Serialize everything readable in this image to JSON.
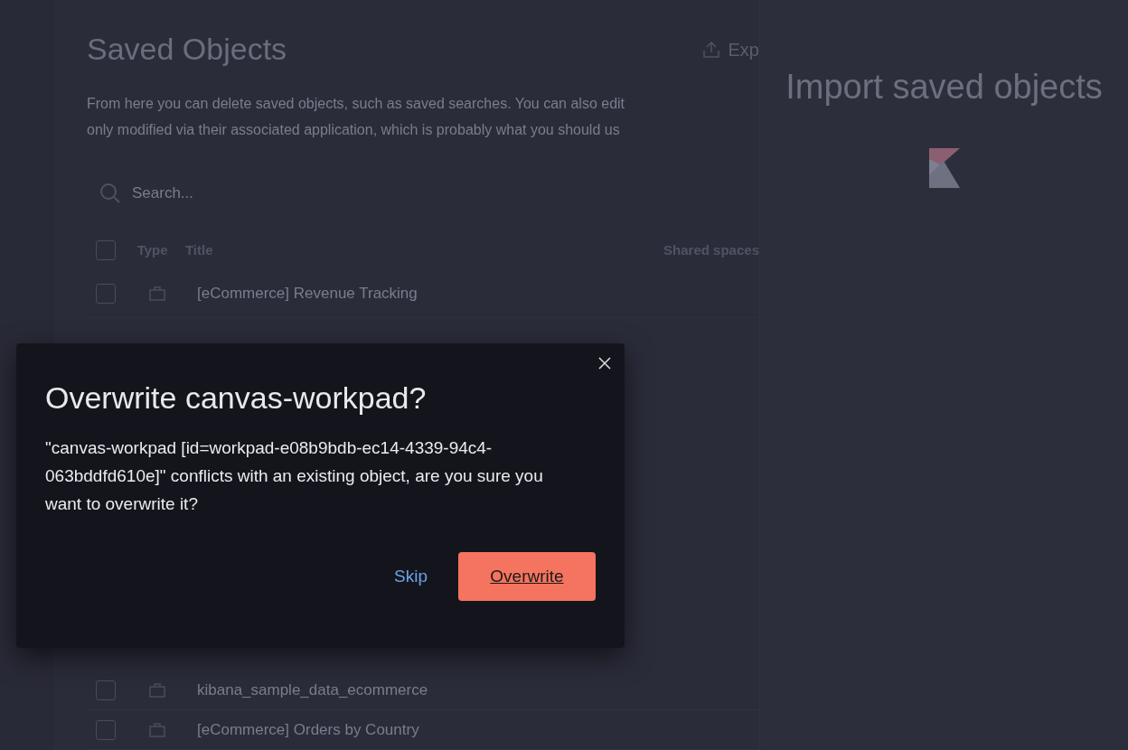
{
  "page": {
    "title": "Saved Objects",
    "export_button": "Exp",
    "description_lines": [
      "From here you can delete saved objects, such as saved searches. You can also edit",
      "only modified via their associated application, which is probably what you should us"
    ],
    "search": {
      "placeholder": "Search..."
    },
    "table": {
      "select_all_checked": false,
      "columns": [
        "Type",
        "Title",
        "Shared spaces"
      ],
      "rows_top": [
        {
          "title": "[eCommerce] Revenue Tracking",
          "checked": false
        }
      ],
      "rows_bottom": [
        {
          "title": "kibana_sample_data_ecommerce",
          "checked": false
        },
        {
          "title": "[eCommerce] Orders by Country",
          "checked": false
        }
      ]
    }
  },
  "flyout": {
    "title": "Import saved objects"
  },
  "modal": {
    "title": "Overwrite canvas-workpad?",
    "message": "\"canvas-workpad [id=workpad-e08b9bdb-ec14-4339-94c4-063bddfd610e]\" conflicts with an existing object, are you sure you want to overwrite it?",
    "buttons": [
      {
        "label": "Skip",
        "kind": "empty"
      },
      {
        "label": "Overwrite",
        "kind": "fill"
      }
    ]
  }
}
